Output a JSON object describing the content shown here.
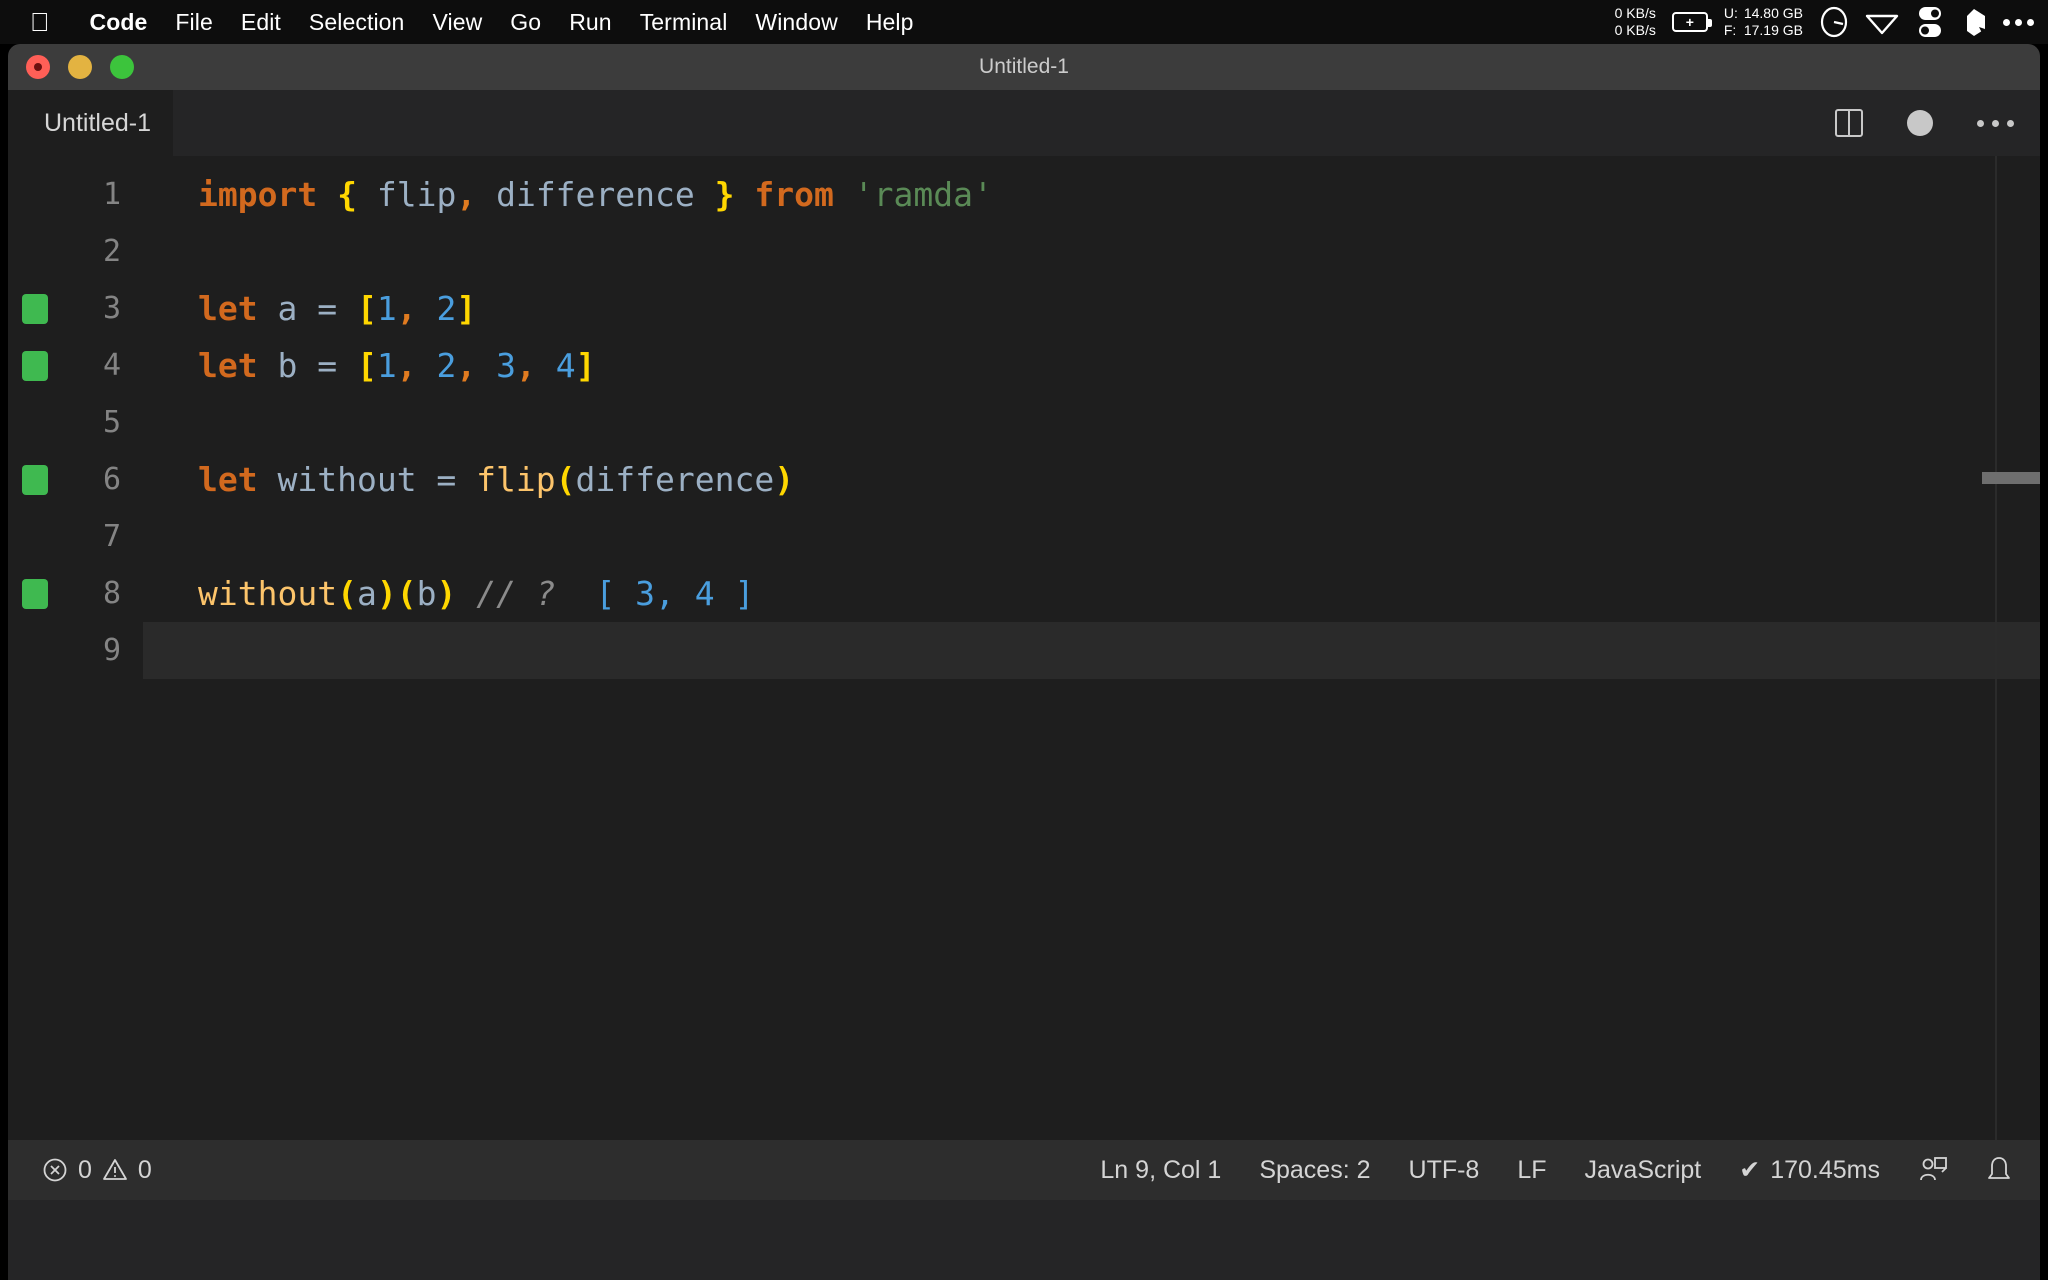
{
  "menubar": {
    "apple_icon": "apple-logo-icon",
    "items": [
      {
        "label": "Code",
        "bold": true
      },
      {
        "label": "File",
        "bold": false
      },
      {
        "label": "Edit",
        "bold": false
      },
      {
        "label": "Selection",
        "bold": false
      },
      {
        "label": "View",
        "bold": false
      },
      {
        "label": "Go",
        "bold": false
      },
      {
        "label": "Run",
        "bold": false
      },
      {
        "label": "Terminal",
        "bold": false
      },
      {
        "label": "Window",
        "bold": false
      },
      {
        "label": "Help",
        "bold": false
      }
    ],
    "status": {
      "net_up": "0 KB/s",
      "net_down": "0 KB/s",
      "battery_icon": "battery-charging-icon",
      "mem_used_key": "U:",
      "mem_used_value": "14.80 GB",
      "mem_free_key": "F:",
      "mem_free_value": "17.19 GB",
      "timer_icon": "timer-icon",
      "wifi_icon": "wifi-icon",
      "toggles_icon": "control-center-icon",
      "dropbox_icon": "dropbox-icon",
      "more_icon": "more-ellipsis-icon"
    }
  },
  "window": {
    "title": "Untitled-1",
    "traffic_lights": [
      "close-button",
      "minimize-button",
      "maximize-button"
    ]
  },
  "tabbar": {
    "tab_label": "Untitled-1",
    "split_icon": "split-editor-icon",
    "dirty_icon": "unsaved-dot-icon",
    "more_icon": "more-actions-icon"
  },
  "editor": {
    "lines": [
      {
        "number": "1",
        "modified": false,
        "active": false,
        "tokens": [
          {
            "t": "import",
            "c": "kw"
          },
          {
            "t": " ",
            "c": "op"
          },
          {
            "t": "{",
            "c": "brace"
          },
          {
            "t": " ",
            "c": "op"
          },
          {
            "t": "flip",
            "c": "var"
          },
          {
            "t": ",",
            "c": "comma"
          },
          {
            "t": " ",
            "c": "op"
          },
          {
            "t": "difference",
            "c": "var"
          },
          {
            "t": " ",
            "c": "op"
          },
          {
            "t": "}",
            "c": "brace"
          },
          {
            "t": " ",
            "c": "op"
          },
          {
            "t": "from",
            "c": "kw"
          },
          {
            "t": " ",
            "c": "op"
          },
          {
            "t": "'ramda'",
            "c": "str"
          }
        ]
      },
      {
        "number": "2",
        "modified": false,
        "active": false,
        "tokens": []
      },
      {
        "number": "3",
        "modified": true,
        "active": false,
        "tokens": [
          {
            "t": "let",
            "c": "kw"
          },
          {
            "t": " ",
            "c": "op"
          },
          {
            "t": "a",
            "c": "var"
          },
          {
            "t": " = ",
            "c": "op"
          },
          {
            "t": "[",
            "c": "brace"
          },
          {
            "t": "1",
            "c": "num"
          },
          {
            "t": ",",
            "c": "comma"
          },
          {
            "t": " ",
            "c": "op"
          },
          {
            "t": "2",
            "c": "num"
          },
          {
            "t": "]",
            "c": "brace"
          }
        ]
      },
      {
        "number": "4",
        "modified": true,
        "active": false,
        "tokens": [
          {
            "t": "let",
            "c": "kw"
          },
          {
            "t": " ",
            "c": "op"
          },
          {
            "t": "b",
            "c": "var"
          },
          {
            "t": " = ",
            "c": "op"
          },
          {
            "t": "[",
            "c": "brace"
          },
          {
            "t": "1",
            "c": "num"
          },
          {
            "t": ",",
            "c": "comma"
          },
          {
            "t": " ",
            "c": "op"
          },
          {
            "t": "2",
            "c": "num"
          },
          {
            "t": ",",
            "c": "comma"
          },
          {
            "t": " ",
            "c": "op"
          },
          {
            "t": "3",
            "c": "num"
          },
          {
            "t": ",",
            "c": "comma"
          },
          {
            "t": " ",
            "c": "op"
          },
          {
            "t": "4",
            "c": "num"
          },
          {
            "t": "]",
            "c": "brace"
          }
        ]
      },
      {
        "number": "5",
        "modified": false,
        "active": false,
        "tokens": []
      },
      {
        "number": "6",
        "modified": true,
        "active": false,
        "tokens": [
          {
            "t": "let",
            "c": "kw"
          },
          {
            "t": " ",
            "c": "op"
          },
          {
            "t": "without",
            "c": "var"
          },
          {
            "t": " = ",
            "c": "op"
          },
          {
            "t": "flip",
            "c": "fn"
          },
          {
            "t": "(",
            "c": "paren"
          },
          {
            "t": "difference",
            "c": "var"
          },
          {
            "t": ")",
            "c": "paren"
          }
        ]
      },
      {
        "number": "7",
        "modified": false,
        "active": false,
        "tokens": []
      },
      {
        "number": "8",
        "modified": true,
        "active": false,
        "tokens": [
          {
            "t": "without",
            "c": "fn"
          },
          {
            "t": "(",
            "c": "paren"
          },
          {
            "t": "a",
            "c": "var"
          },
          {
            "t": ")",
            "c": "paren"
          },
          {
            "t": "(",
            "c": "paren"
          },
          {
            "t": "b",
            "c": "var"
          },
          {
            "t": ")",
            "c": "paren"
          },
          {
            "t": " ",
            "c": "op"
          },
          {
            "t": "// ?",
            "c": "cmt"
          },
          {
            "t": "  ",
            "c": "op"
          },
          {
            "t": "[ 3, 4 ]",
            "c": "num"
          }
        ]
      },
      {
        "number": "9",
        "modified": false,
        "active": true,
        "tokens": []
      }
    ]
  },
  "statusbar": {
    "error_icon": "error-circle-icon",
    "error_count": "0",
    "warning_icon": "warning-triangle-icon",
    "warning_count": "0",
    "cursor_position": "Ln 9, Col 1",
    "indentation": "Spaces: 2",
    "encoding": "UTF-8",
    "eol": "LF",
    "language": "JavaScript",
    "runtime_check": "✔",
    "runtime": "170.45ms",
    "liveshare_icon": "live-share-icon",
    "bell_icon": "notifications-bell-icon"
  },
  "colors": {
    "menubar_bg": "#0d0d0d",
    "titlebar_bg": "#3c3c3c",
    "editor_bg": "#1e1e1e",
    "tabbar_bg": "#252526",
    "statusbar_bg": "#2d2d2d",
    "modified_marker": "#3fb950",
    "keyword": "#d2691e",
    "string": "#5a8a56",
    "number": "#4a9ede",
    "bracket": "#ffd700",
    "function": "#fcc46b",
    "variable": "#9cb0c4",
    "comment": "#8b8b8b"
  }
}
